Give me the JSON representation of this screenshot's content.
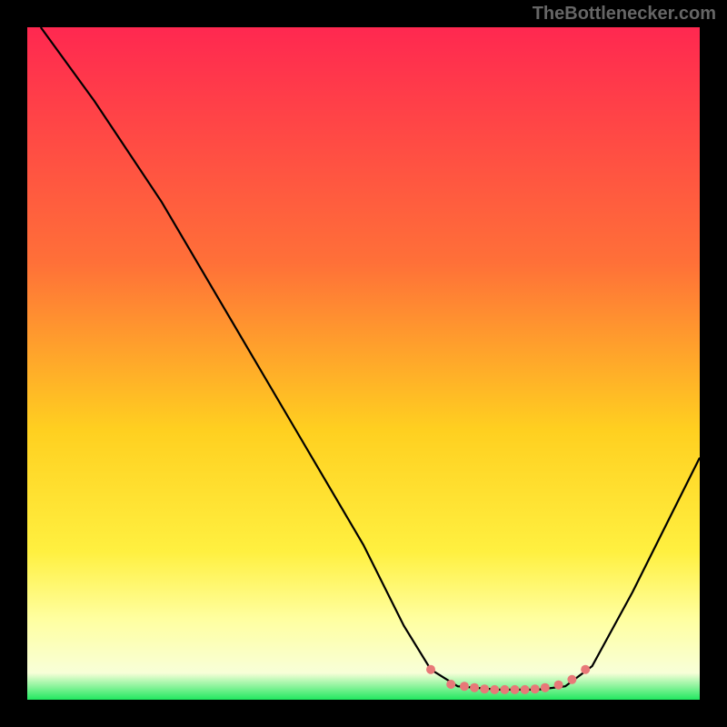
{
  "attribution": "TheBottlenecker.com",
  "chart_data": {
    "type": "line",
    "title": "",
    "xlabel": "",
    "ylabel": "",
    "xlim": [
      0,
      100
    ],
    "ylim": [
      0,
      100
    ],
    "gradient_stops": [
      {
        "offset": 0,
        "color": "#ff2850"
      },
      {
        "offset": 35,
        "color": "#ff7038"
      },
      {
        "offset": 60,
        "color": "#ffd020"
      },
      {
        "offset": 78,
        "color": "#fff040"
      },
      {
        "offset": 88,
        "color": "#ffffa0"
      },
      {
        "offset": 96,
        "color": "#f8ffd8"
      },
      {
        "offset": 100,
        "color": "#20e860"
      }
    ],
    "series": [
      {
        "name": "curve",
        "points": [
          {
            "x": 2,
            "y": 100
          },
          {
            "x": 10,
            "y": 89
          },
          {
            "x": 20,
            "y": 74
          },
          {
            "x": 30,
            "y": 57
          },
          {
            "x": 40,
            "y": 40
          },
          {
            "x": 50,
            "y": 23
          },
          {
            "x": 56,
            "y": 11
          },
          {
            "x": 60,
            "y": 4.5
          },
          {
            "x": 64,
            "y": 2
          },
          {
            "x": 70,
            "y": 1.5
          },
          {
            "x": 76,
            "y": 1.5
          },
          {
            "x": 80,
            "y": 2
          },
          {
            "x": 84,
            "y": 5
          },
          {
            "x": 90,
            "y": 16
          },
          {
            "x": 96,
            "y": 28
          },
          {
            "x": 100,
            "y": 36
          }
        ]
      }
    ],
    "dots": [
      {
        "x": 60,
        "y": 4.5
      },
      {
        "x": 63,
        "y": 2.3
      },
      {
        "x": 65,
        "y": 2.0
      },
      {
        "x": 66.5,
        "y": 1.8
      },
      {
        "x": 68,
        "y": 1.6
      },
      {
        "x": 69.5,
        "y": 1.5
      },
      {
        "x": 71,
        "y": 1.5
      },
      {
        "x": 72.5,
        "y": 1.5
      },
      {
        "x": 74,
        "y": 1.5
      },
      {
        "x": 75.5,
        "y": 1.6
      },
      {
        "x": 77,
        "y": 1.8
      },
      {
        "x": 79,
        "y": 2.2
      },
      {
        "x": 81,
        "y": 3.0
      },
      {
        "x": 83,
        "y": 4.5
      }
    ],
    "dot_color": "#e87878"
  }
}
